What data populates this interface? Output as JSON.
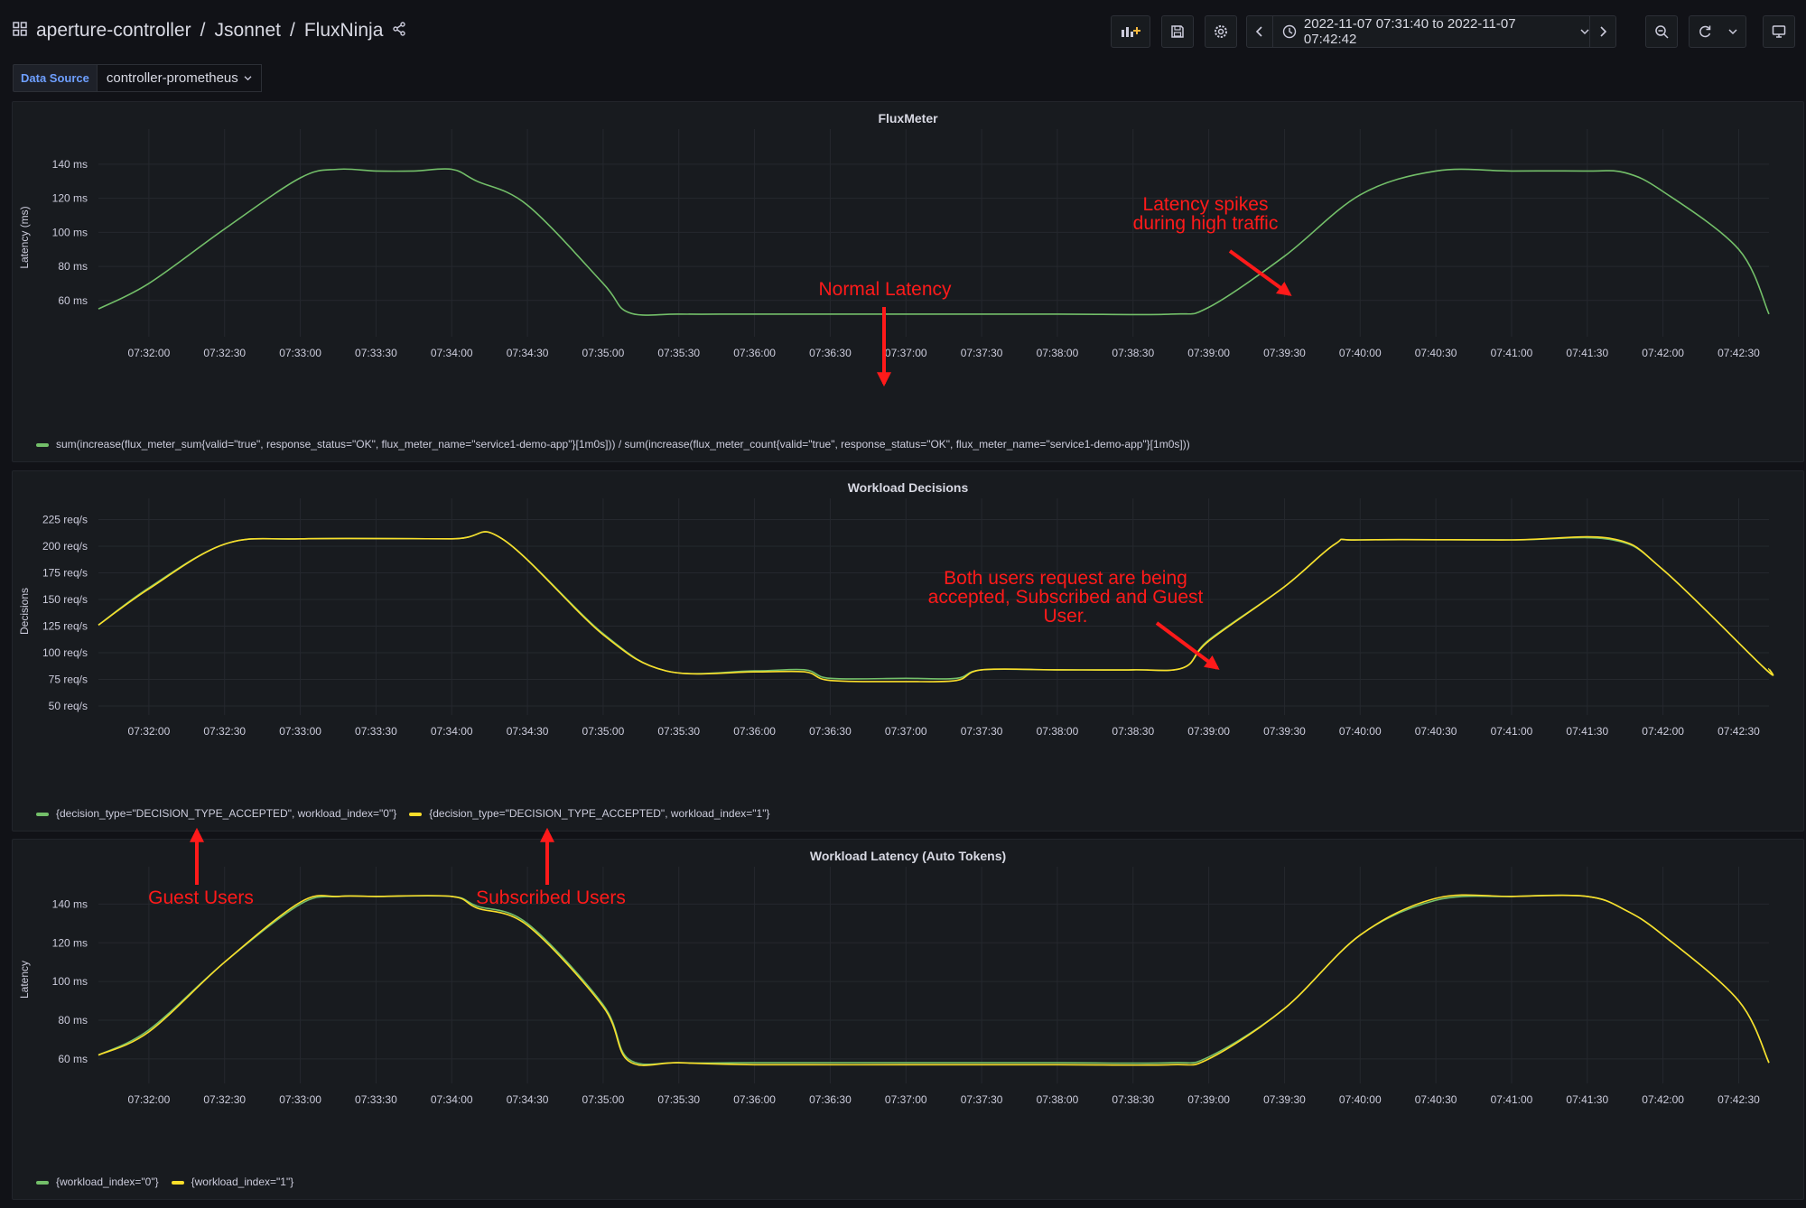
{
  "header": {
    "breadcrumb": [
      "aperture-controller",
      "Jsonnet",
      "FluxNinja"
    ],
    "time_range": "2022-11-07 07:31:40 to 2022-11-07 07:42:42"
  },
  "datasource": {
    "label": "Data Source",
    "value": "controller-prometheus"
  },
  "colors": {
    "green": "#73bf69",
    "yellow": "#fade2a",
    "annotation": "#ff1a1a"
  },
  "x_ticks": [
    "07:32:00",
    "07:32:30",
    "07:33:00",
    "07:33:30",
    "07:34:00",
    "07:34:30",
    "07:35:00",
    "07:35:30",
    "07:36:00",
    "07:36:30",
    "07:37:00",
    "07:37:30",
    "07:38:00",
    "07:38:30",
    "07:39:00",
    "07:39:30",
    "07:40:00",
    "07:40:30",
    "07:41:00",
    "07:41:30",
    "07:42:00",
    "07:42:30"
  ],
  "panels": [
    {
      "title": "FluxMeter",
      "ylabel": "Latency (ms)",
      "legend": [
        {
          "label": "sum(increase(flux_meter_sum{valid=\"true\", response_status=\"OK\", flux_meter_name=\"service1-demo-app\"}[1m0s])) / sum(increase(flux_meter_count{valid=\"true\", response_status=\"OK\", flux_meter_name=\"service1-demo-app\"}[1m0s]))",
          "color": "#73bf69"
        }
      ]
    },
    {
      "title": "Workload Decisions",
      "ylabel": "Decisions",
      "legend": [
        {
          "label": "{decision_type=\"DECISION_TYPE_ACCEPTED\", workload_index=\"0\"}",
          "color": "#73bf69"
        },
        {
          "label": "{decision_type=\"DECISION_TYPE_ACCEPTED\", workload_index=\"1\"}",
          "color": "#fade2a"
        }
      ]
    },
    {
      "title": "Workload Latency (Auto Tokens)",
      "ylabel": "Latency",
      "legend": [
        {
          "label": "{workload_index=\"0\"}",
          "color": "#73bf69"
        },
        {
          "label": "{workload_index=\"1\"}",
          "color": "#fade2a"
        }
      ]
    }
  ],
  "annotations": {
    "normal_latency": "Normal Latency",
    "latency_spikes": "Latency spikes\nduring high traffic",
    "both_users": "Both users request are being\naccepted, Subscribed and Guest\nUser.",
    "guest_users": "Guest Users",
    "subscribed_users": "Subscribed Users"
  },
  "chart_data": [
    {
      "type": "line",
      "title": "FluxMeter",
      "ylabel": "Latency (ms)",
      "x_range": [
        "07:31:40",
        "07:42:42"
      ],
      "yticks": [
        "60 ms",
        "80 ms",
        "100 ms",
        "120 ms",
        "140 ms"
      ],
      "ylim": [
        44,
        150
      ],
      "series": [
        {
          "color": "#73bf69",
          "x": [
            "07:31:40",
            "07:32:00",
            "07:32:30",
            "07:33:00",
            "07:33:15",
            "07:33:30",
            "07:33:45",
            "07:34:00",
            "07:34:10",
            "07:34:30",
            "07:35:00",
            "07:35:10",
            "07:35:30",
            "07:36:00",
            "07:37:00",
            "07:38:00",
            "07:38:45",
            "07:39:00",
            "07:39:30",
            "07:40:00",
            "07:40:30",
            "07:41:00",
            "07:41:30",
            "07:41:45",
            "07:42:00",
            "07:42:30",
            "07:42:42"
          ],
          "values": [
            55,
            70,
            102,
            132,
            137,
            136,
            136,
            137,
            130,
            116,
            70,
            53,
            52,
            52,
            52,
            52,
            52,
            56,
            86,
            122,
            136,
            136,
            136,
            135,
            124,
            90,
            52
          ]
        }
      ]
    },
    {
      "type": "line",
      "title": "Workload Decisions",
      "ylabel": "Decisions",
      "x_range": [
        "07:31:40",
        "07:42:42"
      ],
      "yticks": [
        "50 req/s",
        "75 req/s",
        "100 req/s",
        "125 req/s",
        "150 req/s",
        "175 req/s",
        "200 req/s",
        "225 req/s"
      ],
      "ylim": [
        50,
        228
      ],
      "series": [
        {
          "color": "#73bf69",
          "x": [
            "07:31:40",
            "07:32:00",
            "07:32:30",
            "07:33:00",
            "07:34:00",
            "07:34:20",
            "07:35:00",
            "07:35:25",
            "07:36:00",
            "07:36:20",
            "07:36:30",
            "07:37:00",
            "07:37:20",
            "07:37:30",
            "07:38:00",
            "07:38:30",
            "07:38:50",
            "07:39:00",
            "07:39:30",
            "07:39:50",
            "07:40:00",
            "07:41:00",
            "07:41:40",
            "07:42:00",
            "07:42:40",
            "07:42:42"
          ],
          "values": [
            126,
            161,
            202,
            207,
            207,
            207,
            118,
            83,
            83,
            84,
            76,
            76,
            76,
            84,
            84,
            84,
            86,
            112,
            162,
            202,
            206,
            206,
            206,
            178,
            86,
            85
          ]
        },
        {
          "color": "#fade2a",
          "x": [
            "07:31:40",
            "07:32:00",
            "07:32:30",
            "07:33:00",
            "07:34:00",
            "07:34:20",
            "07:35:00",
            "07:35:25",
            "07:36:00",
            "07:36:20",
            "07:36:30",
            "07:37:00",
            "07:37:20",
            "07:37:30",
            "07:38:00",
            "07:38:30",
            "07:38:50",
            "07:39:00",
            "07:39:30",
            "07:39:50",
            "07:40:00",
            "07:41:00",
            "07:41:40",
            "07:42:00",
            "07:42:40",
            "07:42:42"
          ],
          "values": [
            126,
            160,
            202,
            207,
            207,
            207,
            117,
            83,
            82,
            82,
            74,
            73,
            74,
            84,
            84,
            84,
            86,
            111,
            162,
            202,
            206,
            206,
            207,
            178,
            86,
            85
          ]
        }
      ]
    },
    {
      "type": "line",
      "title": "Workload Latency (Auto Tokens)",
      "ylabel": "Latency",
      "x_range": [
        "07:31:40",
        "07:42:42"
      ],
      "yticks": [
        "60 ms",
        "80 ms",
        "100 ms",
        "120 ms",
        "140 ms"
      ],
      "ylim": [
        52,
        150
      ],
      "series": [
        {
          "color": "#73bf69",
          "x": [
            "07:31:40",
            "07:32:00",
            "07:32:30",
            "07:33:00",
            "07:33:15",
            "07:33:30",
            "07:34:00",
            "07:34:10",
            "07:34:30",
            "07:35:00",
            "07:35:10",
            "07:35:30",
            "07:36:00",
            "07:37:00",
            "07:38:00",
            "07:38:45",
            "07:39:00",
            "07:39:30",
            "07:40:00",
            "07:40:30",
            "07:41:00",
            "07:41:30",
            "07:41:45",
            "07:42:00",
            "07:42:30",
            "07:42:42"
          ],
          "values": [
            62,
            75,
            110,
            140,
            144,
            144,
            144,
            139,
            130,
            88,
            60,
            58,
            58,
            58,
            58,
            58,
            61,
            86,
            124,
            142,
            144,
            144,
            137,
            124,
            90,
            58
          ]
        },
        {
          "color": "#fade2a",
          "x": [
            "07:31:40",
            "07:32:00",
            "07:32:30",
            "07:33:00",
            "07:33:15",
            "07:33:30",
            "07:34:00",
            "07:34:10",
            "07:34:30",
            "07:35:00",
            "07:35:10",
            "07:35:30",
            "07:36:00",
            "07:37:00",
            "07:38:00",
            "07:38:45",
            "07:39:00",
            "07:39:30",
            "07:40:00",
            "07:40:30",
            "07:41:00",
            "07:41:30",
            "07:41:45",
            "07:42:00",
            "07:42:30",
            "07:42:42"
          ],
          "values": [
            62,
            74,
            110,
            141,
            144,
            144,
            144,
            138,
            129,
            87,
            59,
            58,
            57,
            57,
            57,
            57,
            60,
            86,
            124,
            143,
            144,
            144,
            137,
            124,
            90,
            58
          ]
        }
      ]
    }
  ]
}
